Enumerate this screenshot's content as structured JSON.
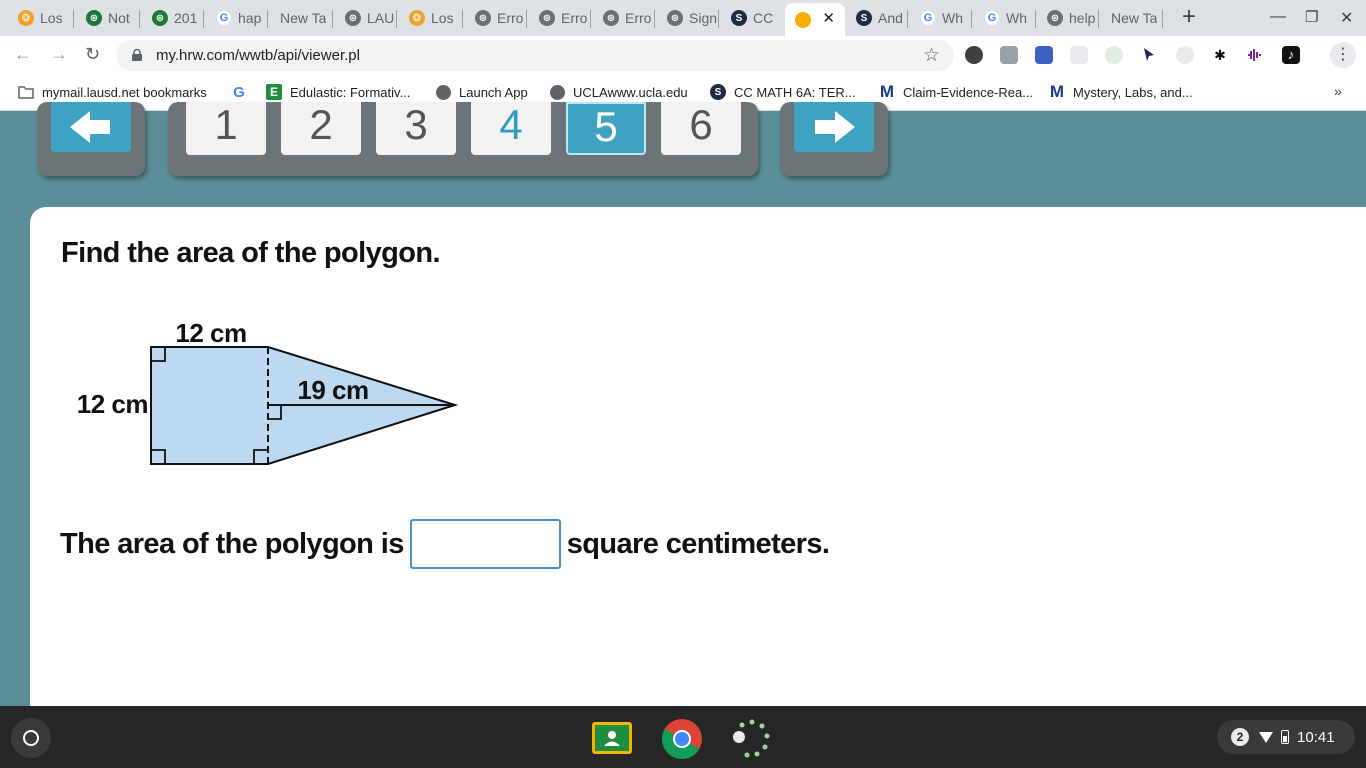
{
  "tabs": [
    {
      "title": "Los",
      "icon": "orange"
    },
    {
      "title": "Not",
      "icon": "green"
    },
    {
      "title": "201",
      "icon": "green"
    },
    {
      "title": "hap",
      "icon": "g"
    },
    {
      "title": "New Tab",
      "icon": "none"
    },
    {
      "title": "LAU",
      "icon": "gray"
    },
    {
      "title": "Los",
      "icon": "orange"
    },
    {
      "title": "Erro",
      "icon": "gray"
    },
    {
      "title": "Erro",
      "icon": "gray"
    },
    {
      "title": "Erro",
      "icon": "gray"
    },
    {
      "title": "Sign",
      "icon": "gray"
    },
    {
      "title": "CC",
      "icon": "s"
    },
    {
      "title": "",
      "icon": "dot",
      "active": true,
      "close": "✕"
    },
    {
      "title": "And",
      "icon": "s"
    },
    {
      "title": "Wh",
      "icon": "g"
    },
    {
      "title": "Wh",
      "icon": "g"
    },
    {
      "title": "help",
      "icon": "gray"
    },
    {
      "title": "New Tab",
      "icon": "none"
    }
  ],
  "toolbar": {
    "url": "my.hrw.com/wwtb/api/viewer.pl"
  },
  "bookmarks": [
    {
      "label": "mymail.lausd.net bookmarks",
      "icon": "folder"
    },
    {
      "label": "",
      "icon": "google"
    },
    {
      "label": "Edulastic: Formativ...",
      "icon": "edulastic"
    },
    {
      "label": "Launch App",
      "icon": "globe"
    },
    {
      "label": "UCLAwww.ucla.edu",
      "icon": "globe"
    },
    {
      "label": "CC MATH 6A: TER...",
      "icon": "s"
    },
    {
      "label": "Claim-Evidence-Rea...",
      "icon": "m"
    },
    {
      "label": "Mystery, Labs, and...",
      "icon": "m"
    }
  ],
  "bookmarks_more": "»",
  "pager": {
    "pages": [
      "1",
      "2",
      "3",
      "4",
      "5",
      "6"
    ],
    "current": "5",
    "answered": [
      "4"
    ]
  },
  "question": {
    "prompt": "Find the area of the polygon.",
    "figure": {
      "top_label": "12 cm",
      "side_label": "12 cm",
      "height_label": "19 cm"
    },
    "answer_prefix": "The area of the polygon is",
    "answer_value": "",
    "answer_suffix": "square centimeters."
  },
  "colors": {
    "shape_fill": "#bcd9f1",
    "accent": "#3ea3c3",
    "background": "#5b8e98"
  },
  "shelf": {
    "notification_count": "2",
    "time": "10:41"
  }
}
